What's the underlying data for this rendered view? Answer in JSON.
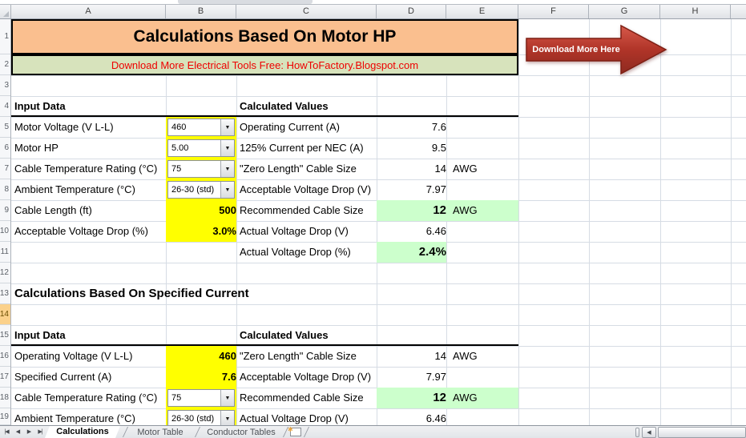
{
  "grid": {
    "cols": [
      "A",
      "B",
      "C",
      "D",
      "E",
      "F",
      "G",
      "H"
    ],
    "rows": [
      "1",
      "2",
      "3",
      "4",
      "5",
      "6",
      "7",
      "8",
      "9",
      "10",
      "11",
      "12",
      "13",
      "14",
      "15",
      "16",
      "17",
      "18",
      "19"
    ]
  },
  "banner": {
    "title": "Calculations Based On Motor HP",
    "promo": "Download More Electrical Tools Free: HowToFactory.Blogspot.com"
  },
  "arrow": {
    "label": "Download More Here"
  },
  "sheet": {
    "motor_section": {
      "input_header": "Input Data",
      "calc_header": "Calculated Values",
      "inputs": [
        {
          "label": "Motor Voltage (V L-L)",
          "value": "460",
          "control": "dropdown"
        },
        {
          "label": "Motor HP",
          "value": "5.00",
          "control": "dropdown"
        },
        {
          "label": "Cable Temperature Rating (°C)",
          "value": "75",
          "control": "dropdown"
        },
        {
          "label": "Ambient Temperature (°C)",
          "value": "26-30 (std)",
          "control": "dropdown"
        },
        {
          "label": "Cable Length (ft)",
          "value": "500",
          "control": "cell"
        },
        {
          "label": "Acceptable Voltage Drop (%)",
          "value": "3.0%",
          "control": "cell"
        }
      ],
      "calcs": [
        {
          "label": "Operating Current (A)",
          "value": "7.6"
        },
        {
          "label": "125% Current per NEC (A)",
          "value": "9.5"
        },
        {
          "label": "\"Zero Length\" Cable Size",
          "value": "14",
          "unit": "AWG"
        },
        {
          "label": "Acceptable Voltage Drop (V)",
          "value": "7.97"
        },
        {
          "label": "Recommended Cable Size",
          "value": "12",
          "unit": "AWG",
          "highlight": true
        },
        {
          "label": "Actual Voltage Drop (V)",
          "value": "6.46"
        },
        {
          "label": "Actual Voltage Drop (%)",
          "value": "2.4%",
          "highlight": true
        }
      ]
    },
    "current_section": {
      "heading": "Calculations Based On Specified Current",
      "input_header": "Input Data",
      "calc_header": "Calculated Values",
      "inputs": [
        {
          "label": "Operating Voltage (V L-L)",
          "value": "460",
          "control": "cell"
        },
        {
          "label": "Specified Current (A)",
          "value": "7.6",
          "control": "cell"
        },
        {
          "label": "Cable Temperature Rating (°C)",
          "value": "75",
          "control": "dropdown"
        },
        {
          "label": "Ambient Temperature (°C)",
          "value": "26-30 (std)",
          "control": "dropdown"
        }
      ],
      "calcs": [
        {
          "label": "\"Zero Length\" Cable Size",
          "value": "14",
          "unit": "AWG"
        },
        {
          "label": "Acceptable Voltage Drop (V)",
          "value": "7.97"
        },
        {
          "label": "Recommended Cable Size",
          "value": "12",
          "unit": "AWG",
          "highlight": true
        },
        {
          "label": "Actual Voltage Drop (V)",
          "value": "6.46"
        }
      ]
    }
  },
  "tabs": {
    "nav": [
      "|◀",
      "◀",
      "▶",
      "▶|"
    ],
    "sheets": [
      {
        "label": "Calculations",
        "active": true
      },
      {
        "label": "Motor Table",
        "active": false
      },
      {
        "label": "Conductor Tables",
        "active": false
      }
    ]
  },
  "icons": {
    "dropdown": "▼",
    "scroll_left": "◀",
    "insert_sheet": "✱"
  },
  "colors": {
    "title_bg": "#FABF8F",
    "promo_bg": "#D7E3BC",
    "promo_text": "#EE0000",
    "input_bg": "#FFFF00",
    "highlight_bg": "#CCFFCC",
    "arrow_red": "#B03428"
  }
}
